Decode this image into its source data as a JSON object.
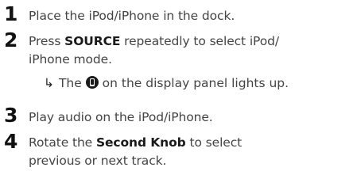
{
  "steps": [
    {
      "number": "1",
      "lines": [
        "Place the iPod/iPhone in the dock."
      ]
    },
    {
      "number": "2",
      "pre": "Press ",
      "bold": "SOURCE",
      "post": " repeatedly to select iPod/",
      "line2": "iPhone mode.",
      "result_arrow": "↳",
      "result_pre": "The ",
      "result_icon": "ipod-iphone-icon",
      "result_post": " on the display panel lights up."
    },
    {
      "number": "3",
      "lines": [
        "Play audio on the iPod/iPhone."
      ]
    },
    {
      "number": "4",
      "pre": "Rotate the ",
      "bold": "Second Knob",
      "post": " to select",
      "line2": "previous or next track."
    }
  ]
}
